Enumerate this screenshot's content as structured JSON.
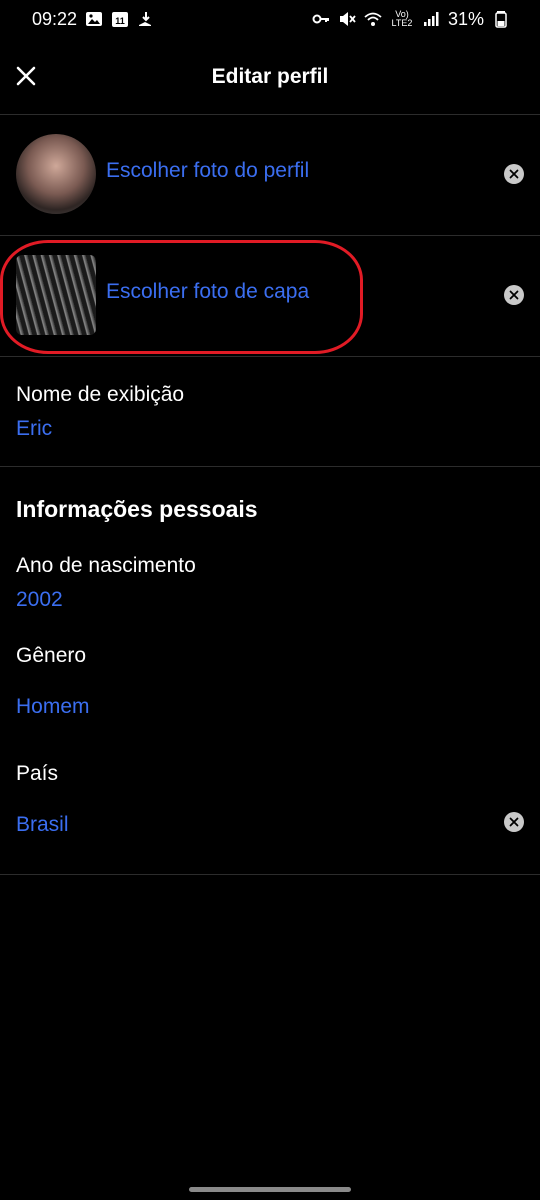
{
  "status_bar": {
    "time": "09:22",
    "calendar_day": "11",
    "network": "Vo) LTE2",
    "battery": "31%"
  },
  "header": {
    "title": "Editar perfil"
  },
  "profile_photo": {
    "label": "Escolher foto do perfil"
  },
  "cover_photo": {
    "label": "Escolher foto de capa"
  },
  "display_name": {
    "label": "Nome de exibição",
    "value": "Eric"
  },
  "personal_info": {
    "title": "Informações pessoais",
    "birth_year": {
      "label": "Ano de nascimento",
      "value": "2002"
    },
    "gender": {
      "label": "Gênero",
      "value": "Homem"
    },
    "country": {
      "label": "País",
      "value": "Brasil"
    }
  },
  "colors": {
    "accent": "#3b6ef0",
    "highlight": "#e11b25",
    "background": "#000000"
  }
}
